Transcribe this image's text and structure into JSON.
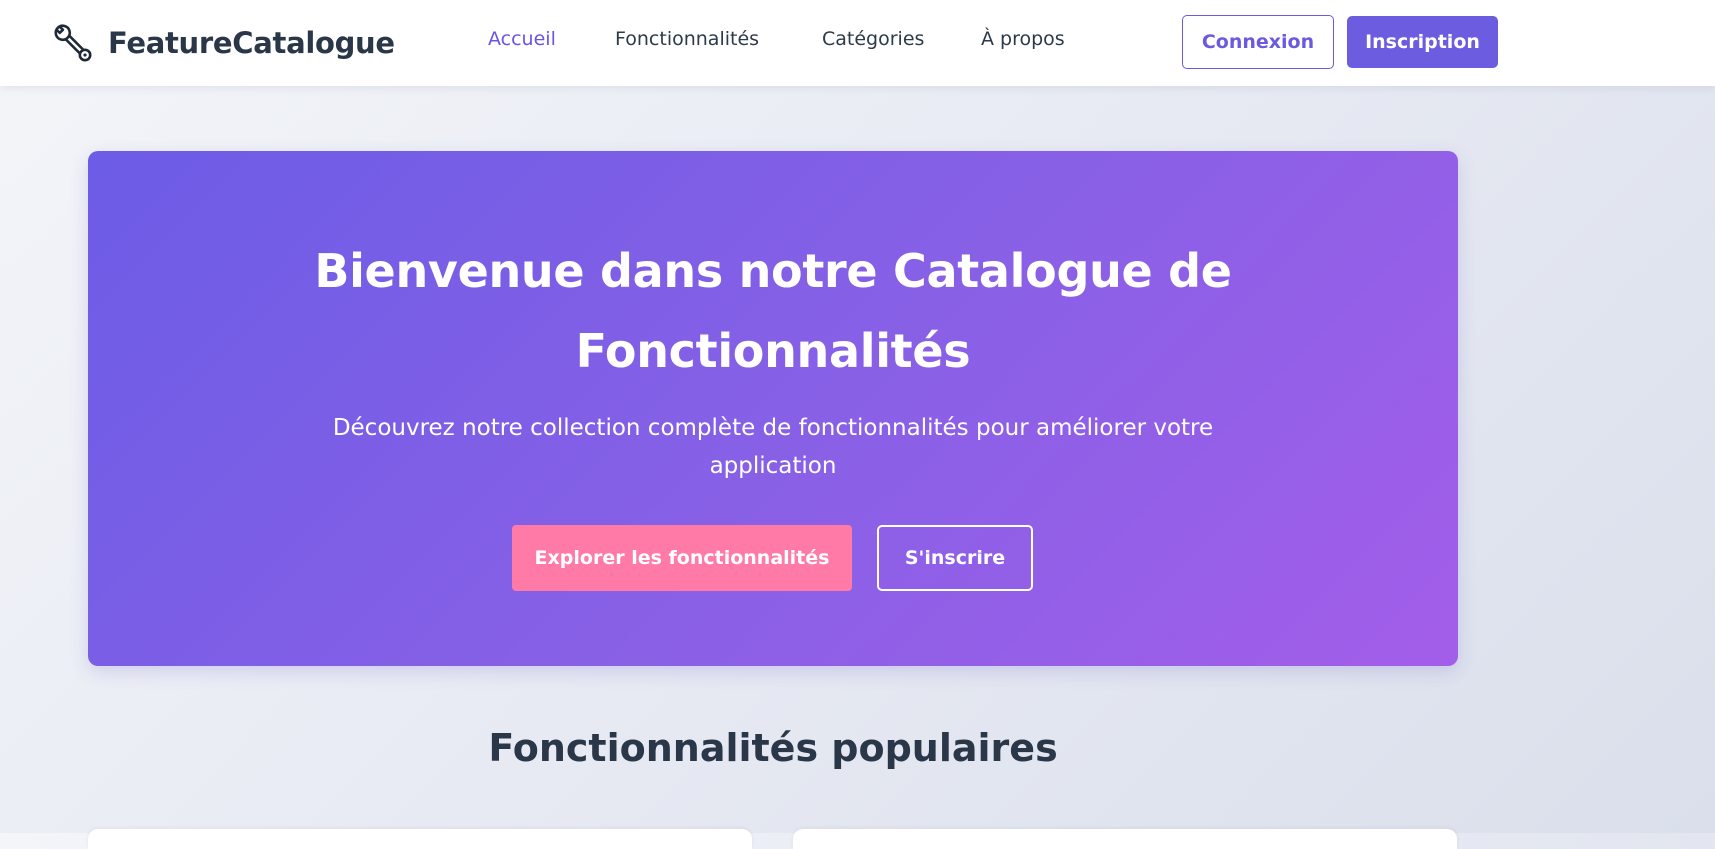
{
  "brand": {
    "name": "FeatureCatalogue",
    "icon": "wrench-icon"
  },
  "nav": {
    "links": [
      {
        "label": "Accueil",
        "active": true
      },
      {
        "label": "Fonctionnalités",
        "active": false
      },
      {
        "label": "Catégories",
        "active": false
      },
      {
        "label": "À propos",
        "active": false
      }
    ],
    "login_label": "Connexion",
    "signup_label": "Inscription"
  },
  "hero": {
    "title": "Bienvenue dans notre Catalogue de Fonctionnalités",
    "subtitle": "Découvrez notre collection complète de fonctionnalités pour améliorer votre application",
    "primary_cta": "Explorer les fonctionnalités",
    "secondary_cta": "S'inscrire"
  },
  "popular": {
    "title": "Fonctionnalités populaires"
  },
  "colors": {
    "accent": "#6c5ce0",
    "hero_gradient_start": "#6c5ce6",
    "hero_gradient_end": "#a35ee9",
    "cta_pink": "#ff7aa6",
    "text_dark": "#2a3748"
  }
}
